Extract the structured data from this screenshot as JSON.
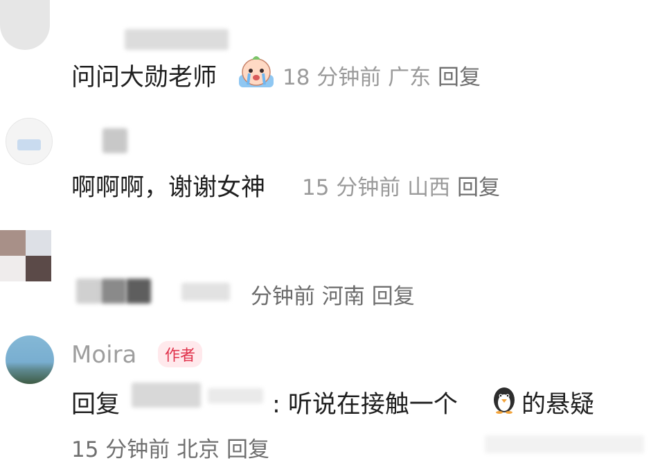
{
  "comments": [
    {
      "text": "问问大勋老师",
      "time": "18 分钟前",
      "location": "广东",
      "reply": "回复",
      "emoji": "crying-bunny-sticker"
    },
    {
      "text": "啊啊啊，谢谢女神",
      "time": "15 分钟前",
      "location": "山西",
      "reply": "回复"
    },
    {
      "time": "分钟前",
      "location": "河南",
      "reply": "回复"
    },
    {
      "username": "Moira",
      "badge": "作者",
      "reply_prefix": "回复",
      "text": ": 听说在接触一个",
      "text_suffix": "的悬疑",
      "emoji": "penguin-emoji",
      "time": "15 分钟前",
      "location": "北京",
      "reply": "回复"
    }
  ],
  "colors": {
    "badge_text": "#e0324b",
    "badge_bg": "#ffe9ec",
    "meta_text": "#9a9a9a"
  }
}
